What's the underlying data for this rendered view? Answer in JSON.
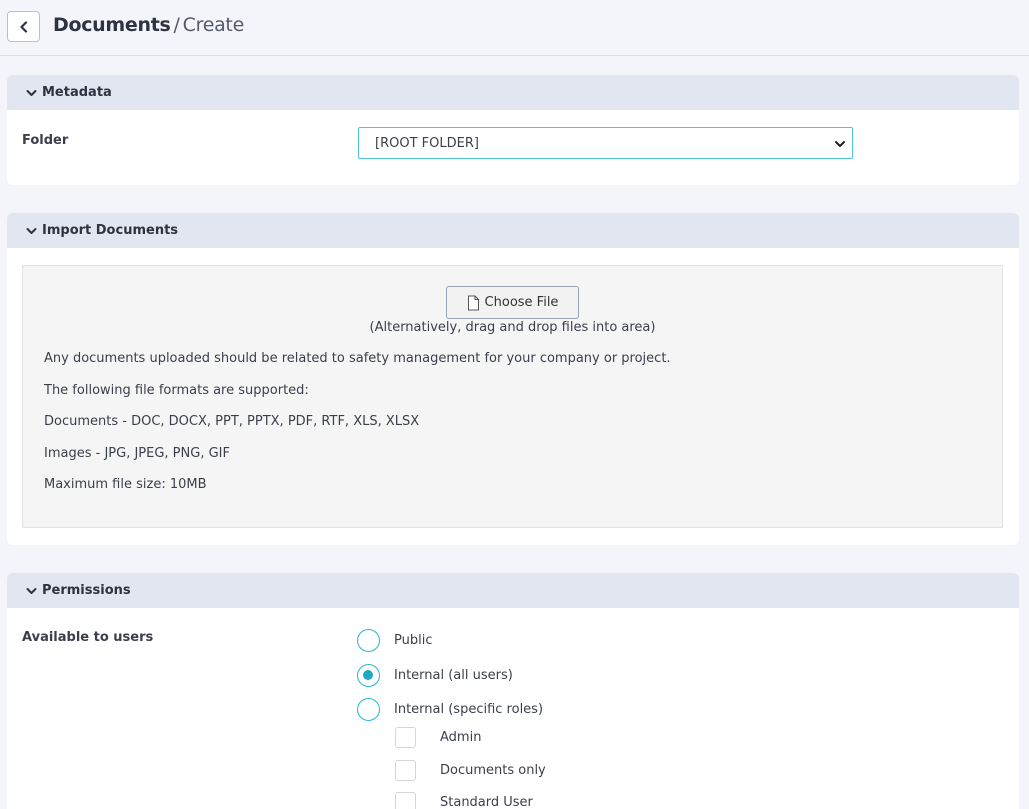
{
  "header": {
    "breadcrumb_root": "Documents",
    "breadcrumb_separator": "/",
    "breadcrumb_leaf": "Create"
  },
  "metadata": {
    "title": "Metadata",
    "folder_label": "Folder",
    "folder_value": "[ROOT FOLDER]"
  },
  "import": {
    "title": "Import Documents",
    "choose_file_label": "Choose File",
    "drag_hint": "(Alternatively, drag and drop files into area)",
    "info_lines": [
      "Any documents uploaded should be related to safety management for your company or project.",
      "The following file formats are supported:",
      "Documents - DOC, DOCX, PPT, PPTX, PDF, RTF, XLS, XLSX",
      "Images - JPG, JPEG, PNG, GIF",
      "Maximum file size: 10MB"
    ]
  },
  "permissions": {
    "title": "Permissions",
    "available_label": "Available to users",
    "options": [
      {
        "label": "Public",
        "checked": false
      },
      {
        "label": "Internal (all users)",
        "checked": true
      },
      {
        "label": "Internal (specific roles)",
        "checked": false
      }
    ],
    "roles": [
      {
        "label": "Admin",
        "checked": false
      },
      {
        "label": "Documents only",
        "checked": false
      },
      {
        "label": "Standard User",
        "checked": false
      }
    ]
  },
  "colors": {
    "accent": "#1ea8c4",
    "page_bg": "#f3f5fb",
    "section_header_bg": "#e2e6f1"
  },
  "icons": {
    "back": "chevron-left-icon",
    "section_toggle": "chevron-down-icon",
    "select_caret": "chevron-down-icon",
    "file": "file-icon"
  }
}
